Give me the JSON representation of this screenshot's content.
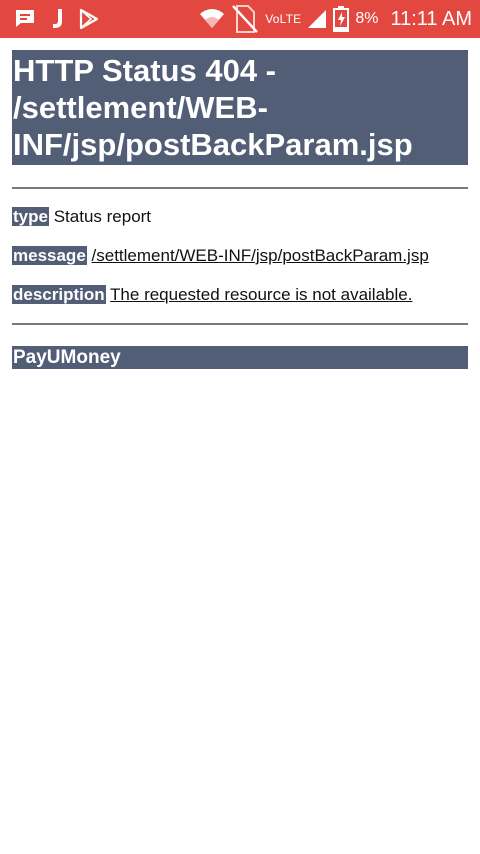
{
  "status_bar": {
    "left_icons": [
      "message-icon",
      "j-app-icon",
      "play-store-icon"
    ],
    "right_icons": [
      "wifi-icon",
      "no-sim-icon",
      "cellular-signal-icon",
      "battery-charging-icon"
    ],
    "volte": "VoLTE",
    "battery": "8%",
    "time": "11:11 AM",
    "color": "#e2483f"
  },
  "page": {
    "title": "HTTP Status 404 - /settlement/WEB-INF/jsp/postBackParam.jsp",
    "type_label": "type",
    "type_value": "Status report",
    "message_label": "message",
    "message_value": "/settlement/WEB-INF/jsp/postBackParam.jsp",
    "description_label": "description",
    "description_value": "The requested resource is not available.",
    "footer": "PayUMoney",
    "accent_color": "#525d76"
  }
}
